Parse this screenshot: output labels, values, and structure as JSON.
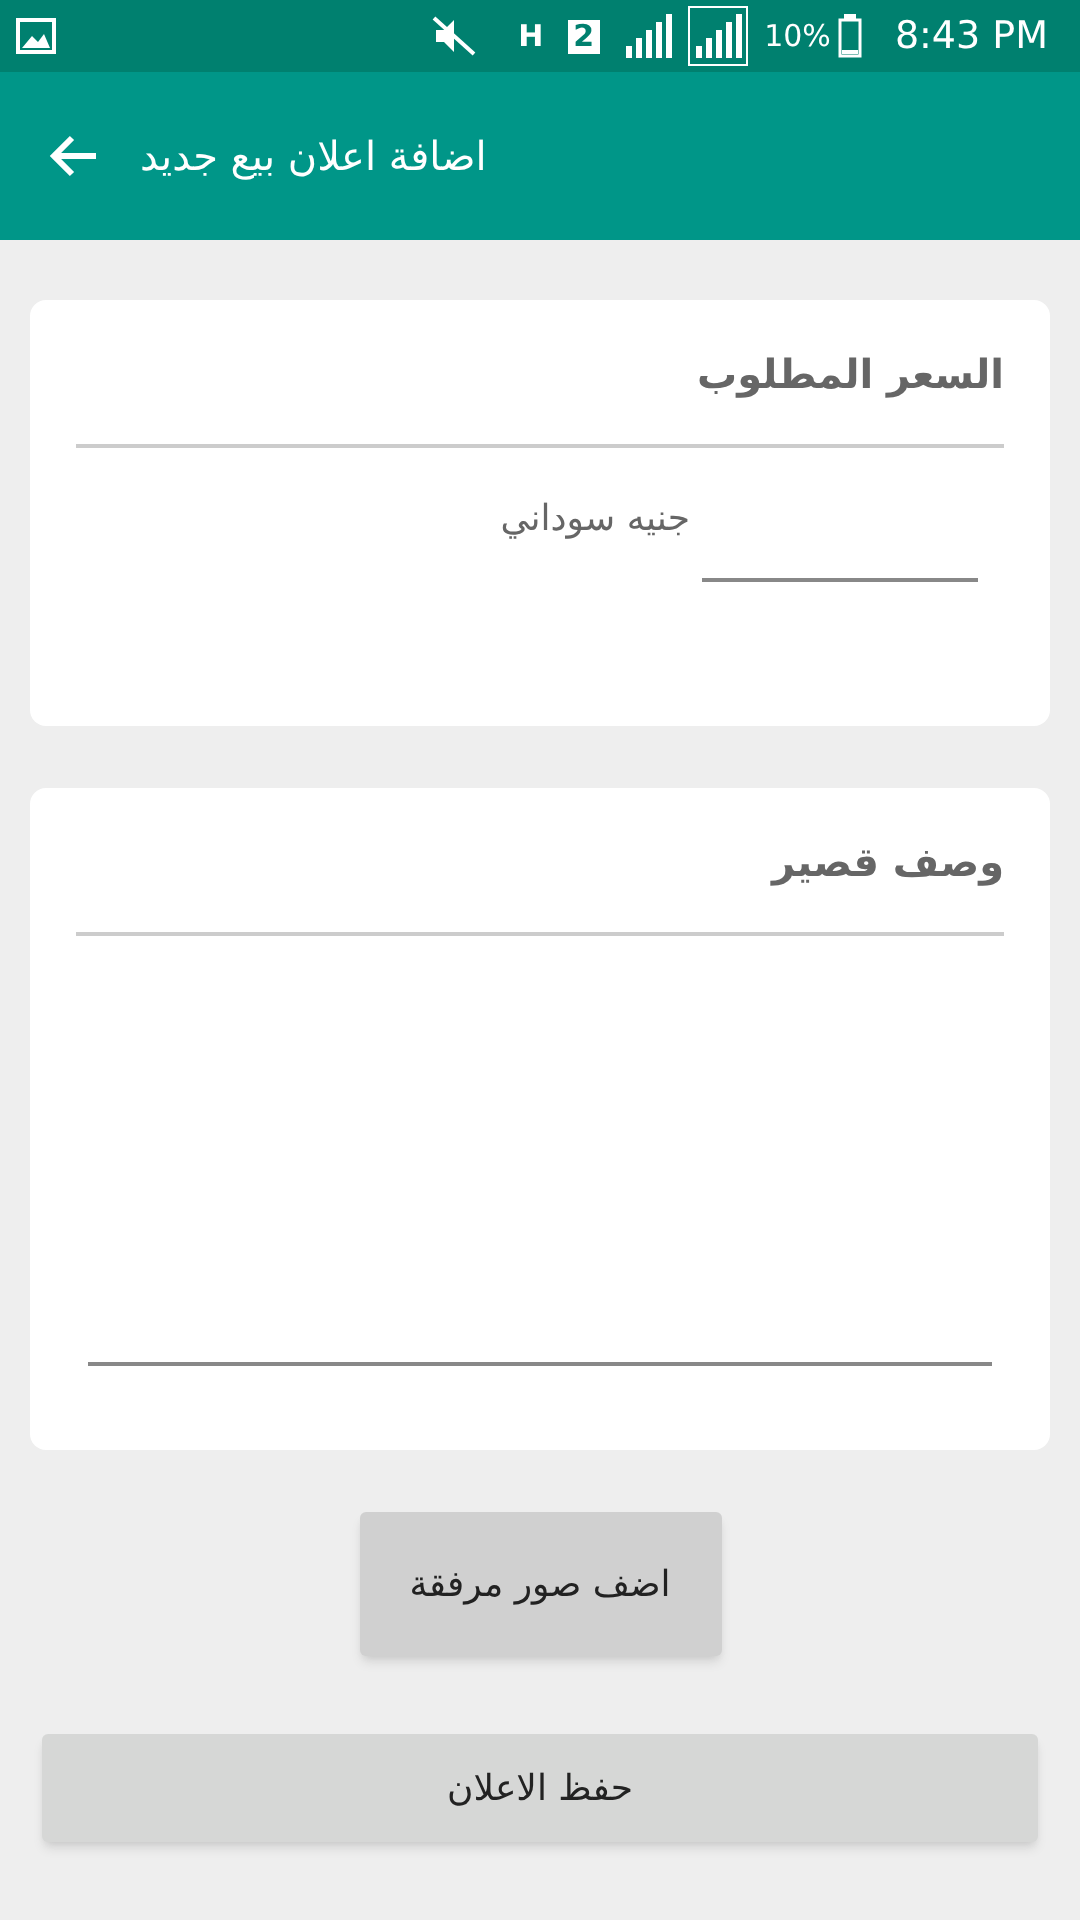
{
  "status_bar": {
    "network": "H",
    "sim": "2",
    "battery": "10%",
    "time": "8:43 PM"
  },
  "app_bar": {
    "title": "اضافة اعلان بيع جديد"
  },
  "price_card": {
    "title": "السعر المطلوب",
    "currency": "جنيه سوداني"
  },
  "description_card": {
    "title": "وصف قصير"
  },
  "buttons": [
    {
      "label": "اضف صور مرفقة",
      "kind": "small"
    },
    {
      "label": "حفظ الاعلان",
      "kind": "wide"
    }
  ]
}
